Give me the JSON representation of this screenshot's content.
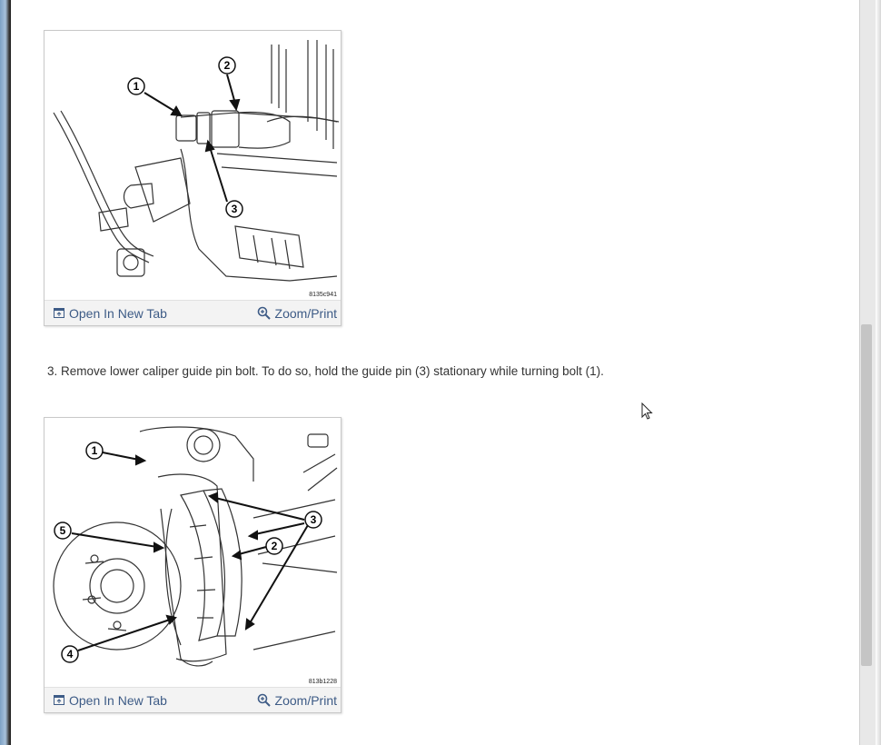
{
  "figures": [
    {
      "code": "8135c941",
      "callouts": [
        "1",
        "2",
        "3"
      ],
      "open_label": "Open In New Tab",
      "zoom_label": "Zoom/Print"
    },
    {
      "code": "813b1228",
      "callouts": [
        "1",
        "2",
        "3",
        "4",
        "5"
      ],
      "open_label": "Open In New Tab",
      "zoom_label": "Zoom/Print"
    }
  ],
  "step_text": "3. Remove lower caliper guide pin bolt. To do so, hold the guide pin (3) stationary while turning bolt (1).",
  "icons": {
    "open": "open-in-new-tab-icon",
    "zoom": "magnifier-zoom-icon",
    "cursor": "mouse-pointer-icon"
  },
  "colors": {
    "link": "#3d5b86",
    "bar": "#f3f3f3",
    "text": "#333333"
  }
}
